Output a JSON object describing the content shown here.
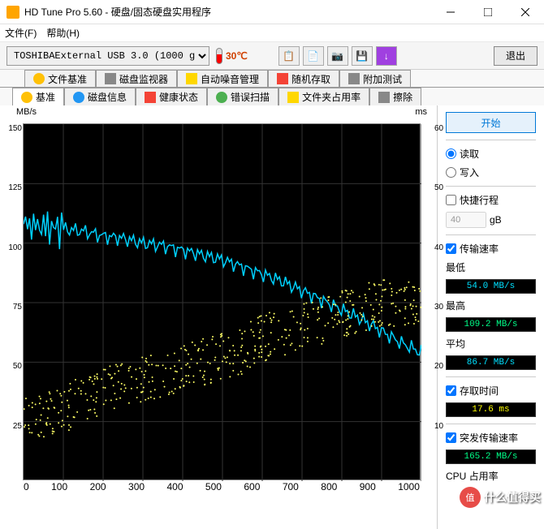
{
  "window": {
    "title": "HD Tune Pro 5.60 - 硬盘/固态硬盘实用程序"
  },
  "menu": {
    "file": "文件(F)",
    "help": "帮助(H)"
  },
  "toolbar": {
    "drive": "TOSHIBAExternal USB 3.0 (1000 gB)",
    "temp": "30℃",
    "exit": "退出"
  },
  "tabs_top": {
    "file_benchmark": "文件基准",
    "disk_monitor": "磁盘监视器",
    "noise_mgmt": "自动噪音管理",
    "random_access": "随机存取",
    "extra_tests": "附加测试"
  },
  "tabs_bottom": {
    "benchmark": "基准",
    "disk_info": "磁盘信息",
    "health": "健康状态",
    "error_scan": "错误扫描",
    "folder_usage": "文件夹占用率",
    "erase": "擦除"
  },
  "chart": {
    "y_left_unit": "MB/s",
    "y_right_unit": "ms",
    "y_left_ticks": [
      "150",
      "125",
      "100",
      "75",
      "50",
      "25"
    ],
    "y_right_ticks": [
      "60",
      "50",
      "40",
      "30",
      "20",
      "10"
    ],
    "x_ticks": [
      "0",
      "100",
      "200",
      "300",
      "400",
      "500",
      "600",
      "700",
      "800",
      "900",
      "1000"
    ]
  },
  "side": {
    "start": "开始",
    "read": "读取",
    "write": "写入",
    "quick_stroke": "快捷行程",
    "stroke_value": "40",
    "stroke_unit": "gB",
    "transfer_rate": "传输速率",
    "min_label": "最低",
    "min_val": "54.0 MB/s",
    "max_label": "最高",
    "max_val": "109.2 MB/s",
    "avg_label": "平均",
    "avg_val": "86.7 MB/s",
    "access_time": "存取时间",
    "access_val": "17.6 ms",
    "burst_rate": "突发传输速率",
    "burst_val": "165.2 MB/s",
    "cpu_usage": "CPU 占用率"
  },
  "watermark": {
    "badge": "值",
    "text": "什么值得买"
  },
  "chart_data": {
    "type": "line",
    "title": "",
    "xlabel": "gB",
    "series": [
      {
        "name": "Transfer Rate",
        "unit": "MB/s",
        "color": "#00d0ff",
        "x": [
          0,
          50,
          100,
          150,
          200,
          250,
          300,
          350,
          400,
          450,
          500,
          550,
          600,
          650,
          700,
          750,
          800,
          850,
          900,
          950,
          1000
        ],
        "y": [
          108,
          107,
          106,
          105,
          103,
          102,
          100,
          99,
          97,
          95,
          93,
          90,
          87,
          84,
          80,
          76,
          72,
          68,
          63,
          58,
          54
        ]
      },
      {
        "name": "Access Time",
        "unit": "ms",
        "color": "#ffff66",
        "type": "scatter",
        "x": [
          0,
          50,
          100,
          150,
          200,
          250,
          300,
          350,
          400,
          450,
          500,
          550,
          600,
          650,
          700,
          750,
          800,
          850,
          900,
          950,
          1000
        ],
        "y": [
          10,
          11,
          12,
          14,
          15,
          16,
          17,
          18,
          19,
          20,
          21,
          22,
          24,
          25,
          26,
          27,
          28,
          29,
          30,
          30,
          30
        ]
      }
    ],
    "y_left_range": [
      0,
      150
    ],
    "y_right_range": [
      0,
      60
    ],
    "x_range": [
      0,
      1000
    ]
  }
}
